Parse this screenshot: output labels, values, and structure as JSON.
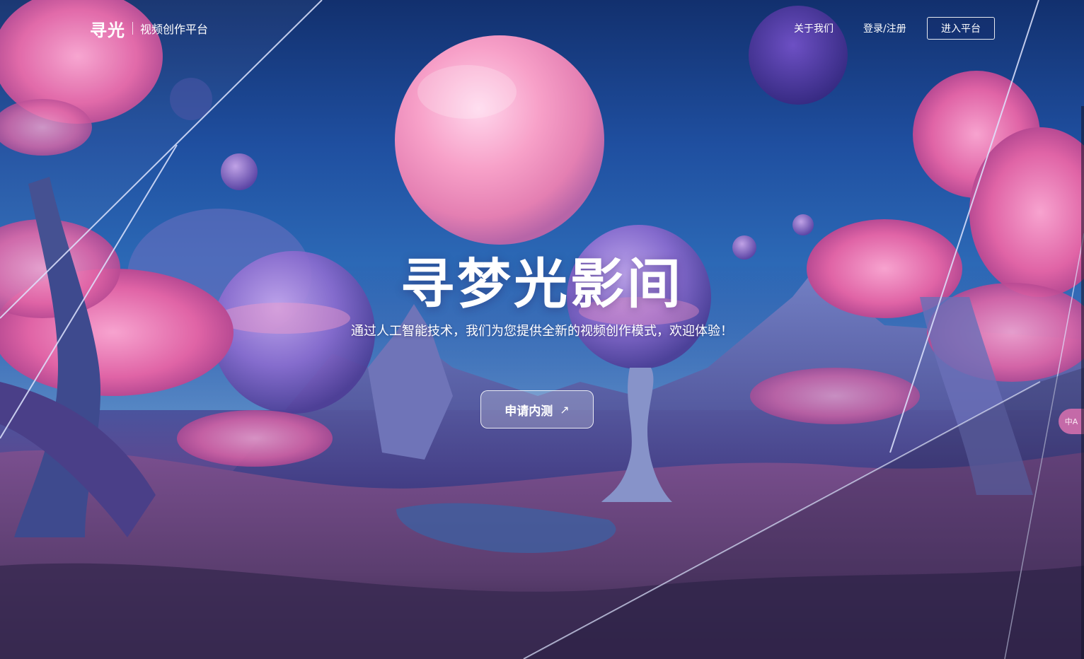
{
  "brand": {
    "logo": "寻光",
    "subtitle": "视频创作平台"
  },
  "nav": {
    "about": "关于我们",
    "login": "登录/注册",
    "enter_platform": "进入平台"
  },
  "hero": {
    "title": "寻梦光影间",
    "subtitle": "通过人工智能技术，我们为您提供全新的视频创作模式，欢迎体验！",
    "apply_button": "申请内测",
    "apply_icon": "arrow-up-right-icon"
  },
  "widget": {
    "translate_icon": "translate-icon",
    "translate_text": "中A"
  },
  "colors": {
    "sky_top": "#12306e",
    "sky_mid": "#2c69b6",
    "foliage_pink": "#e56aa8",
    "ground": "#4a3a6e"
  }
}
